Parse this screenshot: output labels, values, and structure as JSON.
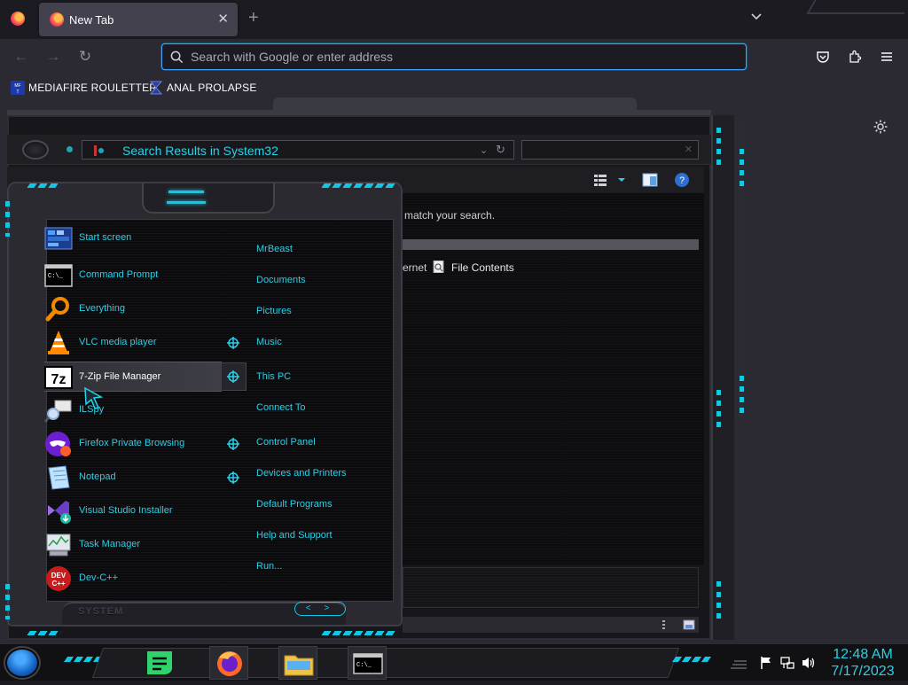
{
  "browser": {
    "tab_title": "New Tab",
    "tab_close": "✕",
    "new_tab": "+",
    "url_placeholder": "Search with Google or enter address",
    "nav": {
      "back": "←",
      "forward": "→",
      "reload": "↻"
    },
    "bookmarks": [
      {
        "label": "MEDIAFIRE ROULETTER",
        "icon": "mediafire-icon"
      },
      {
        "label": "ANAL PROLAPSE",
        "icon": "bookmark-icon"
      }
    ]
  },
  "explorer": {
    "address": "Search Results in System32",
    "search_status": "match your search.",
    "partial_text": "ernet",
    "file_contents_label": "File Contents"
  },
  "start_menu": {
    "programs": [
      {
        "label": "Start screen",
        "icon": "start-screen-icon",
        "jump": false
      },
      {
        "label": "Command Prompt",
        "icon": "command-prompt-icon",
        "jump": false
      },
      {
        "label": "Everything",
        "icon": "everything-search-icon",
        "jump": false
      },
      {
        "label": "VLC media player",
        "icon": "vlc-cone-icon",
        "jump": true
      },
      {
        "label": "7-Zip File Manager",
        "icon": "7zip-icon",
        "jump": true,
        "selected": true
      },
      {
        "label": "ILSpy",
        "icon": "ilspy-icon",
        "jump": false
      },
      {
        "label": "Firefox Private Browsing",
        "icon": "firefox-private-icon",
        "jump": true
      },
      {
        "label": "Notepad",
        "icon": "notepad-icon",
        "jump": true
      },
      {
        "label": "Visual Studio Installer",
        "icon": "visual-studio-installer-icon",
        "jump": false
      },
      {
        "label": "Task Manager",
        "icon": "task-manager-icon",
        "jump": false
      },
      {
        "label": "Dev-C++",
        "icon": "dev-cpp-icon",
        "jump": false
      }
    ],
    "places": [
      "MrBeast",
      "Documents",
      "Pictures",
      "Music",
      "This PC",
      "Connect To",
      "Control Panel",
      "Devices and Printers",
      "Default Programs",
      "Help and Support",
      "Run..."
    ],
    "footer_label": "SYSTEM",
    "nav_arrows": "< >"
  },
  "taskbar": {
    "time": "12:48 AM",
    "date": "7/17/2023",
    "apps": [
      "notes-app-icon",
      "firefox-icon",
      "file-explorer-icon",
      "command-prompt-icon"
    ]
  },
  "colors": {
    "accent": "#2ad0e6",
    "browser_bg": "#2b2a33",
    "tab_bg": "#42414d",
    "url_focus": "#45a1ff"
  }
}
